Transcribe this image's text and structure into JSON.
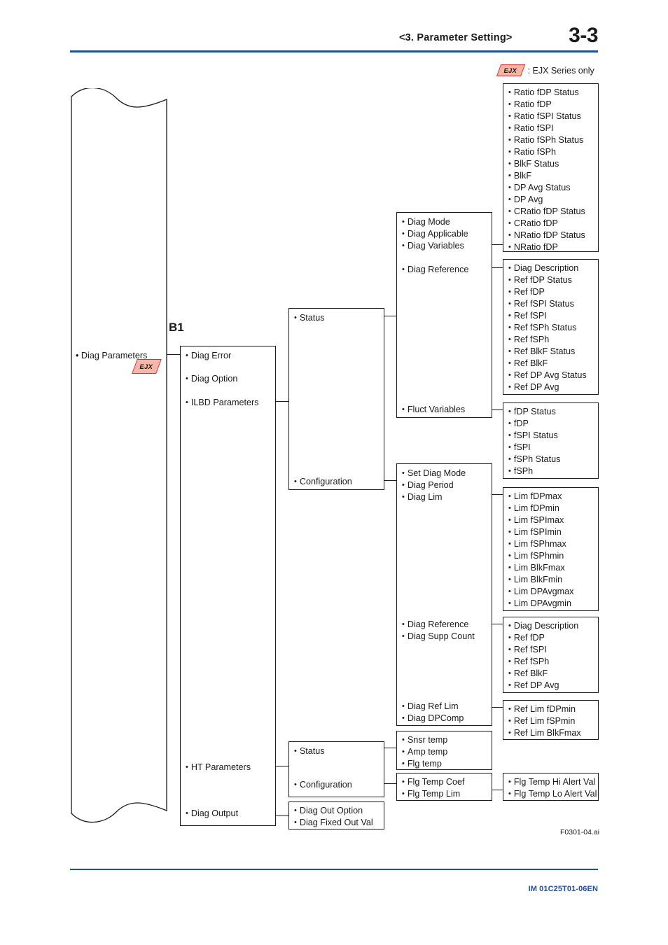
{
  "header": {
    "section_title": "<3.  Parameter Setting>",
    "page_number": "3-3"
  },
  "legend": {
    "badge_label": "EJX",
    "description": ": EJX Series only"
  },
  "diagram": {
    "figure_code": "F0301-04.ai",
    "group_tag": "B1",
    "root_box": {
      "items": [
        "Diag Parameters"
      ],
      "badge_label": "EJX"
    },
    "level1_box": {
      "items": [
        "Diag Error",
        "Diag Option",
        "ILBD Parameters",
        "HT Parameters",
        "Diag Output"
      ]
    },
    "ilbd_status_config_box": {
      "items": [
        "Status",
        "Configuration"
      ]
    },
    "ht_status_config_box": {
      "items": [
        "Status",
        "Configuration"
      ]
    },
    "diag_status_box": {
      "items": [
        "Diag Mode",
        "Diag Applicable",
        "Diag Variables",
        "Diag Reference",
        "Fluct Variables"
      ]
    },
    "diag_config_box": {
      "items": [
        "Set Diag Mode",
        "Diag Period",
        "Diag Lim",
        "Diag Reference",
        "Diag Supp Count",
        "Diag Ref Lim",
        "Diag DPComp"
      ]
    },
    "ratio_box": {
      "items": [
        "Ratio fDP Status",
        "Ratio fDP",
        "Ratio fSPI Status",
        "Ratio fSPI",
        "Ratio fSPh Status",
        "Ratio fSPh",
        "BlkF Status",
        "BlkF",
        "DP Avg Status",
        "DP Avg",
        "CRatio fDP Status",
        "CRatio fDP",
        "NRatio fDP Status",
        "NRatio fDP"
      ]
    },
    "ref_status_box": {
      "items": [
        "Diag Description",
        "Ref fDP Status",
        "Ref fDP",
        "Ref fSPI Status",
        "Ref fSPI",
        "Ref fSPh Status",
        "Ref fSPh",
        "Ref BlkF Status",
        "Ref BlkF",
        "Ref DP Avg Status",
        "Ref DP Avg"
      ]
    },
    "fluct_box": {
      "items": [
        "fDP Status",
        "fDP",
        "fSPI Status",
        "fSPI",
        "fSPh Status",
        "fSPh"
      ]
    },
    "lim_box": {
      "items": [
        "Lim fDPmax",
        "Lim fDPmin",
        "Lim fSPImax",
        "Lim fSPImin",
        "Lim fSPhmax",
        "Lim fSPhmin",
        "Lim BlkFmax",
        "Lim BlkFmin",
        "Lim DPAvgmax",
        "Lim DPAvgmin"
      ]
    },
    "ref_box": {
      "items": [
        "Diag Description",
        "Ref fDP",
        "Ref fSPI",
        "Ref fSPh",
        "Ref BlkF",
        "Ref DP Avg"
      ]
    },
    "ref_lim_box": {
      "items": [
        "Ref Lim fDPmin",
        "Ref Lim fSPmin",
        "Ref Lim BlkFmax"
      ]
    },
    "temp_box": {
      "items": [
        "Snsr temp",
        "Amp temp",
        "Flg temp"
      ]
    },
    "flg_temp_box": {
      "items": [
        "Flg Temp Coef",
        "Flg Temp Lim"
      ]
    },
    "flg_alert_box": {
      "items": [
        "Flg Temp Hi Alert Val",
        "Flg Temp Lo Alert Val"
      ]
    },
    "diag_out_box": {
      "items": [
        "Diag Out Option",
        "Diag Fixed Out Val"
      ]
    }
  },
  "footer": {
    "document_code": "IM 01C25T01-06EN"
  },
  "colors": {
    "rule_blue": "#1f4e9c",
    "badge_fill": "#f6b6a5",
    "badge_border": "#e03030",
    "line": "#1a1a1a"
  }
}
